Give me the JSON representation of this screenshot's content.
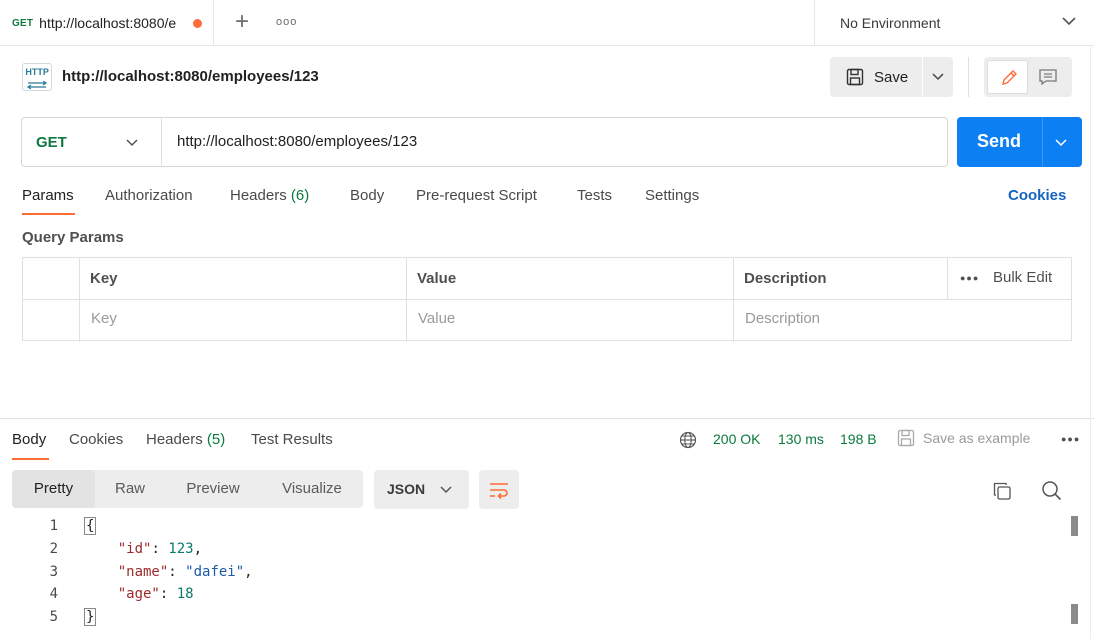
{
  "tab": {
    "method": "GET",
    "title": "http://localhost:8080/e"
  },
  "environment": {
    "label": "No Environment"
  },
  "request": {
    "icon_label": "HTTP",
    "title": "http://localhost:8080/employees/123",
    "save_label": "Save",
    "method": "GET",
    "url": "http://localhost:8080/employees/123",
    "send_label": "Send"
  },
  "request_tabs": [
    {
      "label": "Params",
      "count": ""
    },
    {
      "label": "Authorization",
      "count": ""
    },
    {
      "label": "Headers",
      "count": "(6)"
    },
    {
      "label": "Body",
      "count": ""
    },
    {
      "label": "Pre-request Script",
      "count": ""
    },
    {
      "label": "Tests",
      "count": ""
    },
    {
      "label": "Settings",
      "count": ""
    }
  ],
  "cookies_label": "Cookies",
  "query_params": {
    "title": "Query Params",
    "headers": [
      "Key",
      "Value",
      "Description"
    ],
    "bulk_edit": "Bulk Edit",
    "placeholders": [
      "Key",
      "Value",
      "Description"
    ]
  },
  "response": {
    "tabs": [
      {
        "label": "Body",
        "count": ""
      },
      {
        "label": "Cookies",
        "count": ""
      },
      {
        "label": "Headers",
        "count": "(5)"
      },
      {
        "label": "Test Results",
        "count": ""
      }
    ],
    "status": "200 OK",
    "time": "130 ms",
    "size": "198 B",
    "save_example": "Save as example",
    "views": [
      "Pretty",
      "Raw",
      "Preview",
      "Visualize"
    ],
    "format": "JSON",
    "lines": [
      "1",
      "2",
      "3",
      "4",
      "5"
    ],
    "json": {
      "open": "{",
      "close": "}",
      "id_key": "\"id\"",
      "id_val": "123",
      "name_key": "\"name\"",
      "name_val": "\"dafei\"",
      "age_key": "\"age\"",
      "age_val": "18"
    }
  },
  "colors": {
    "accent": "#ff6c37",
    "send": "#0c7ff2",
    "method": "#0c7a3e",
    "link": "#1565c0"
  }
}
